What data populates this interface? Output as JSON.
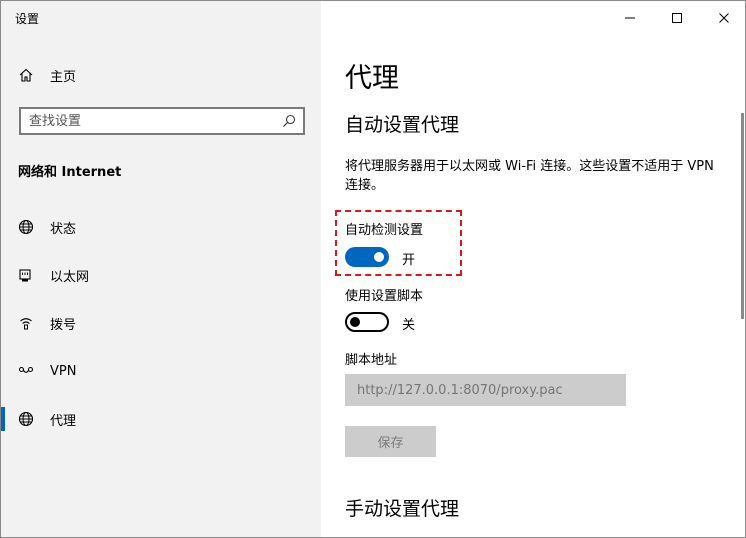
{
  "window": {
    "title": "设置",
    "controls": {
      "minimize_icon": "minimize-icon",
      "maximize_icon": "maximize-icon",
      "close_icon": "close-icon"
    }
  },
  "sidebar": {
    "home": {
      "label": "主页",
      "icon": "home-icon"
    },
    "search": {
      "placeholder": "查找设置",
      "icon": "search-icon"
    },
    "section": "网络和 Internet",
    "items": [
      {
        "label": "状态",
        "icon": "globe-icon"
      },
      {
        "label": "以太网",
        "icon": "ethernet-icon"
      },
      {
        "label": "拨号",
        "icon": "dialup-icon"
      },
      {
        "label": "VPN",
        "icon": "vpn-icon"
      },
      {
        "label": "代理",
        "icon": "globe-icon",
        "active": true
      }
    ]
  },
  "main": {
    "title": "代理",
    "auto_section": "自动设置代理",
    "description": "将代理服务器用于以太网或 Wi-Fi 连接。这些设置不适用于 VPN 连接。",
    "auto_detect": {
      "label": "自动检测设置",
      "state": "开",
      "on": true
    },
    "use_script": {
      "label": "使用设置脚本",
      "state": "关",
      "on": false
    },
    "script_address": {
      "label": "脚本地址",
      "placeholder": "http://127.0.0.1:8070/proxy.pac"
    },
    "save_label": "保存",
    "manual_section": "手动设置代理"
  },
  "colors": {
    "accent": "#0067c0",
    "highlight": "#e0141c",
    "sidebar_bg": "#f2f2f2"
  }
}
